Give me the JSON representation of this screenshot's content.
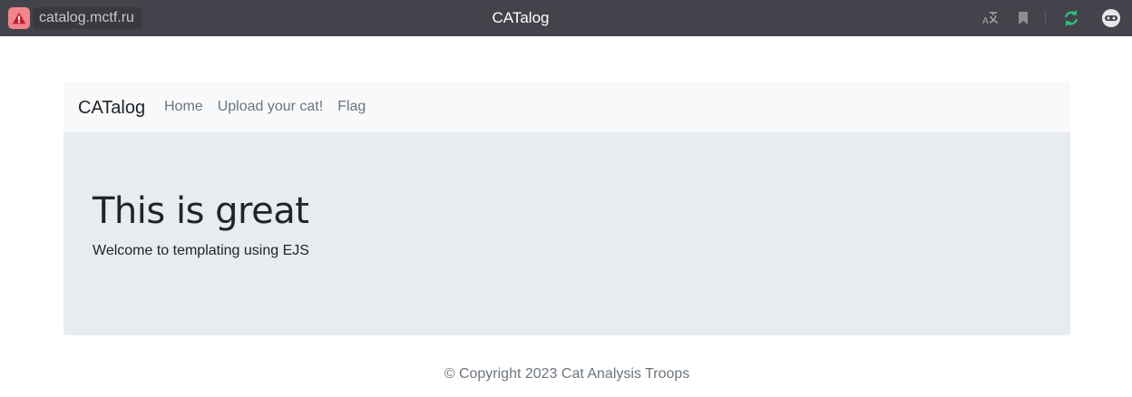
{
  "browser": {
    "url": "catalog.mctf.ru",
    "tab_title": "CATalog",
    "icons": {
      "security": "warning-icon",
      "translate": "translate-icon",
      "bookmark": "bookmark-icon",
      "reload": "reload-icon",
      "profile": "profile-icon"
    },
    "colors": {
      "bar": "#44434b",
      "security_badge": "#f0868c",
      "reload": "#2ec27e"
    }
  },
  "navbar": {
    "brand": "CATalog",
    "links": [
      "Home",
      "Upload your cat!",
      "Flag"
    ]
  },
  "jumbotron": {
    "title": "This is great",
    "text": "Welcome to templating using EJS"
  },
  "footer": {
    "text": "© Copyright 2023 Cat Analysis Troops"
  }
}
